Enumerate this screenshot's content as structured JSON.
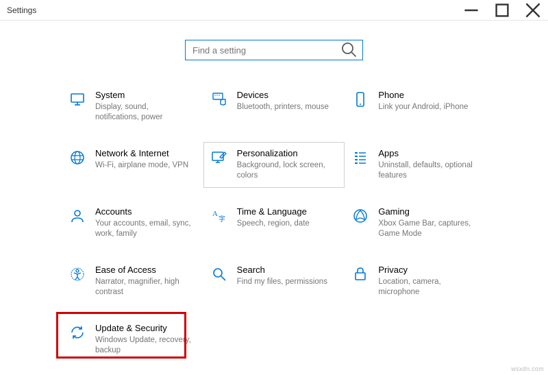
{
  "window": {
    "title": "Settings"
  },
  "search": {
    "placeholder": "Find a setting"
  },
  "tiles": {
    "system": {
      "title": "System",
      "desc": "Display, sound, notifications, power"
    },
    "devices": {
      "title": "Devices",
      "desc": "Bluetooth, printers, mouse"
    },
    "phone": {
      "title": "Phone",
      "desc": "Link your Android, iPhone"
    },
    "network": {
      "title": "Network & Internet",
      "desc": "Wi-Fi, airplane mode, VPN"
    },
    "personalization": {
      "title": "Personalization",
      "desc": "Background, lock screen, colors"
    },
    "apps": {
      "title": "Apps",
      "desc": "Uninstall, defaults, optional features"
    },
    "accounts": {
      "title": "Accounts",
      "desc": "Your accounts, email, sync, work, family"
    },
    "time": {
      "title": "Time & Language",
      "desc": "Speech, region, date"
    },
    "gaming": {
      "title": "Gaming",
      "desc": "Xbox Game Bar, captures, Game Mode"
    },
    "ease": {
      "title": "Ease of Access",
      "desc": "Narrator, magnifier, high contrast"
    },
    "search_cat": {
      "title": "Search",
      "desc": "Find my files, permissions"
    },
    "privacy": {
      "title": "Privacy",
      "desc": "Location, camera, microphone"
    },
    "update": {
      "title": "Update & Security",
      "desc": "Windows Update, recovery, backup"
    }
  },
  "source_watermark": "wsxdn.com"
}
